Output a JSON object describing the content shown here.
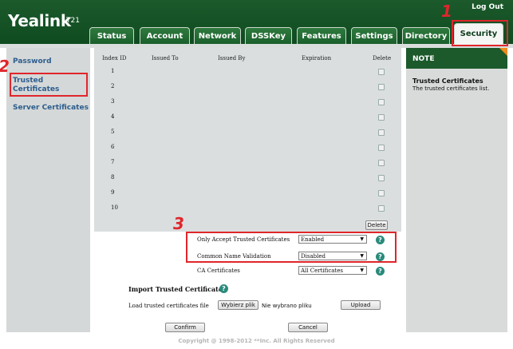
{
  "header": {
    "brand": "Yealink",
    "model": "T21",
    "logout": "Log Out",
    "tabs": [
      {
        "label": "Status",
        "active": false
      },
      {
        "label": "Account",
        "active": false
      },
      {
        "label": "Network",
        "active": false
      },
      {
        "label": "DSSKey",
        "active": false
      },
      {
        "label": "Features",
        "active": false
      },
      {
        "label": "Settings",
        "active": false
      },
      {
        "label": "Directory",
        "active": false
      },
      {
        "label": "Security",
        "active": true
      }
    ]
  },
  "sidebar": {
    "items": [
      {
        "label": "Password"
      },
      {
        "label": "Trusted Certificates",
        "selected": true
      },
      {
        "label": "Server Certificates"
      }
    ]
  },
  "table": {
    "columns": [
      "Index ID",
      "Issued To",
      "Issued By",
      "Expiration",
      "Delete"
    ],
    "rows": [
      "1",
      "2",
      "3",
      "4",
      "5",
      "6",
      "7",
      "8",
      "9",
      "10"
    ],
    "delete_label": "Delete"
  },
  "settings": {
    "only_accept_label": "Only Accept Trusted Certificates",
    "only_accept_value": "Enabled",
    "common_name_label": "Common Name Validation",
    "common_name_value": "Disabled",
    "ca_label": "CA Certificates",
    "ca_value": "All Certificates"
  },
  "import": {
    "title": "Import Trusted Certificates",
    "load_label": "Load trusted certificates file",
    "choose_label": "Wybierz plik",
    "no_file_text": "Nie wybrano pliku",
    "upload_label": "Upload"
  },
  "actions": {
    "confirm_label": "Confirm",
    "cancel_label": "Cancel"
  },
  "note": {
    "heading": "NOTE",
    "title": "Trusted Certificates",
    "text": "The trusted certificates list."
  },
  "annotations": [
    "1",
    "2",
    "3"
  ],
  "footer": {
    "copyright": "Copyright @ 1998-2012 **Inc. All Rights Reserved"
  },
  "colors": {
    "header_green": "#1c5a2c",
    "annotation_red": "#e0262b",
    "link_blue": "#2c5d8e",
    "note_corner_orange": "#f28b1d"
  }
}
